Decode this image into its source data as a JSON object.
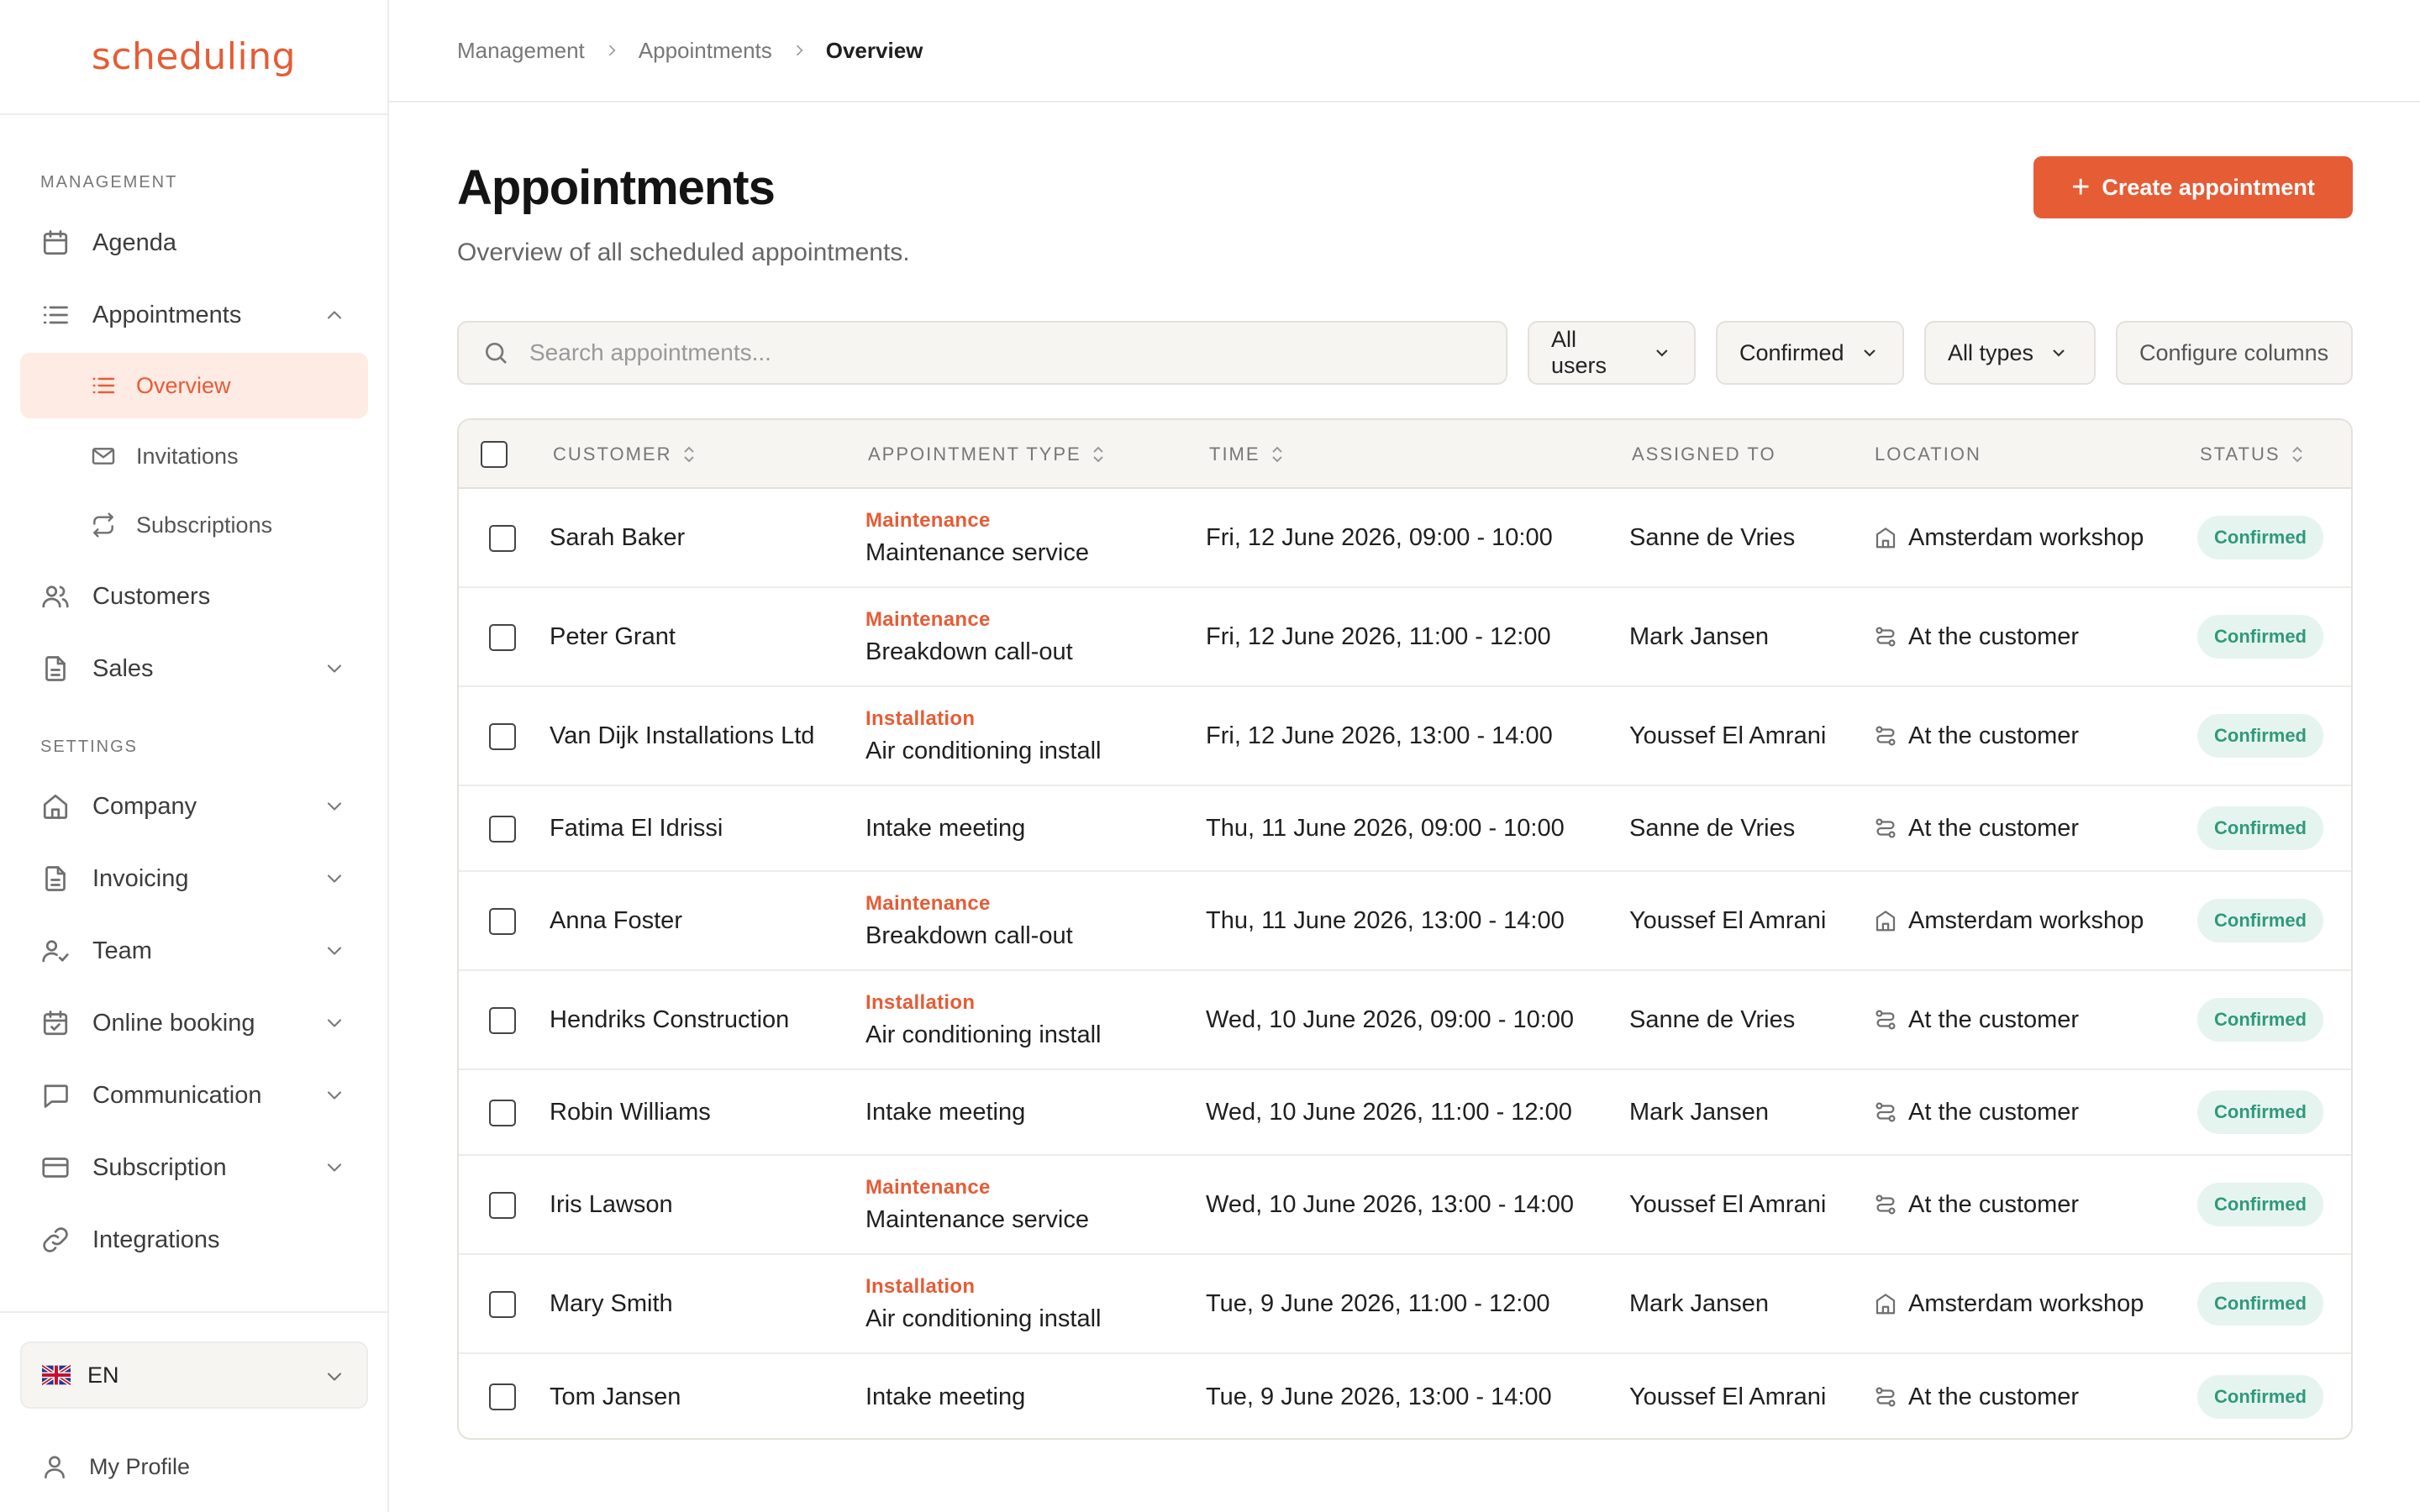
{
  "app": {
    "logo": "scheduling"
  },
  "breadcrumb": [
    "Management",
    "Appointments",
    "Overview"
  ],
  "sidebar": {
    "management_label": "MANAGEMENT",
    "settings_label": "SETTINGS",
    "items": {
      "agenda": "Agenda",
      "appointments": "Appointments",
      "overview": "Overview",
      "invitations": "Invitations",
      "subscriptions": "Subscriptions",
      "customers": "Customers",
      "sales": "Sales",
      "company": "Company",
      "invoicing": "Invoicing",
      "team": "Team",
      "online_booking": "Online booking",
      "communication": "Communication",
      "subscription": "Subscription",
      "integrations": "Integrations"
    },
    "language": "EN",
    "profile": "My Profile"
  },
  "header": {
    "title": "Appointments",
    "subtitle": "Overview of all scheduled appointments.",
    "create_button": "Create appointment"
  },
  "filters": {
    "search_placeholder": "Search appointments...",
    "users": "All users",
    "status": "Confirmed",
    "types": "All types",
    "configure": "Configure columns"
  },
  "table": {
    "columns": [
      "CUSTOMER",
      "APPOINTMENT TYPE",
      "TIME",
      "ASSIGNED TO",
      "LOCATION",
      "STATUS"
    ],
    "rows": [
      {
        "customer": "Sarah Baker",
        "category": "Maintenance",
        "type": "Maintenance service",
        "time": "Fri, 12 June 2026, 09:00 - 10:00",
        "assigned": "Sanne de Vries",
        "location": "Amsterdam workshop",
        "location_icon": "building-icon",
        "status": "Confirmed"
      },
      {
        "customer": "Peter Grant",
        "category": "Maintenance",
        "type": "Breakdown call-out",
        "time": "Fri, 12 June 2026, 11:00 - 12:00",
        "assigned": "Mark Jansen",
        "location": "At the customer",
        "location_icon": "route-icon",
        "status": "Confirmed"
      },
      {
        "customer": "Van Dijk Installations Ltd",
        "category": "Installation",
        "type": "Air conditioning install",
        "time": "Fri, 12 June 2026, 13:00 - 14:00",
        "assigned": "Youssef El Amrani",
        "location": "At the customer",
        "location_icon": "route-icon",
        "status": "Confirmed"
      },
      {
        "customer": "Fatima El Idrissi",
        "category": "",
        "type": "Intake meeting",
        "time": "Thu, 11 June 2026, 09:00 - 10:00",
        "assigned": "Sanne de Vries",
        "location": "At the customer",
        "location_icon": "route-icon",
        "status": "Confirmed"
      },
      {
        "customer": "Anna Foster",
        "category": "Maintenance",
        "type": "Breakdown call-out",
        "time": "Thu, 11 June 2026, 13:00 - 14:00",
        "assigned": "Youssef El Amrani",
        "location": "Amsterdam workshop",
        "location_icon": "building-icon",
        "status": "Confirmed"
      },
      {
        "customer": "Hendriks Construction",
        "category": "Installation",
        "type": "Air conditioning install",
        "time": "Wed, 10 June 2026, 09:00 - 10:00",
        "assigned": "Sanne de Vries",
        "location": "At the customer",
        "location_icon": "route-icon",
        "status": "Confirmed"
      },
      {
        "customer": "Robin Williams",
        "category": "",
        "type": "Intake meeting",
        "time": "Wed, 10 June 2026, 11:00 - 12:00",
        "assigned": "Mark Jansen",
        "location": "At the customer",
        "location_icon": "route-icon",
        "status": "Confirmed"
      },
      {
        "customer": "Iris Lawson",
        "category": "Maintenance",
        "type": "Maintenance service",
        "time": "Wed, 10 June 2026, 13:00 - 14:00",
        "assigned": "Youssef El Amrani",
        "location": "At the customer",
        "location_icon": "route-icon",
        "status": "Confirmed"
      },
      {
        "customer": "Mary Smith",
        "category": "Installation",
        "type": "Air conditioning install",
        "time": "Tue, 9 June 2026, 11:00 - 12:00",
        "assigned": "Mark Jansen",
        "location": "Amsterdam workshop",
        "location_icon": "building-icon",
        "status": "Confirmed"
      },
      {
        "customer": "Tom Jansen",
        "category": "",
        "type": "Intake meeting",
        "time": "Tue, 9 June 2026, 13:00 - 14:00",
        "assigned": "Youssef El Amrani",
        "location": "At the customer",
        "location_icon": "route-icon",
        "status": "Confirmed"
      }
    ]
  },
  "colors": {
    "accent": "#e65c35",
    "accent_soft": "#fdebe4",
    "badge_bg": "#e6f4ef",
    "badge_text": "#2f9a7a"
  }
}
